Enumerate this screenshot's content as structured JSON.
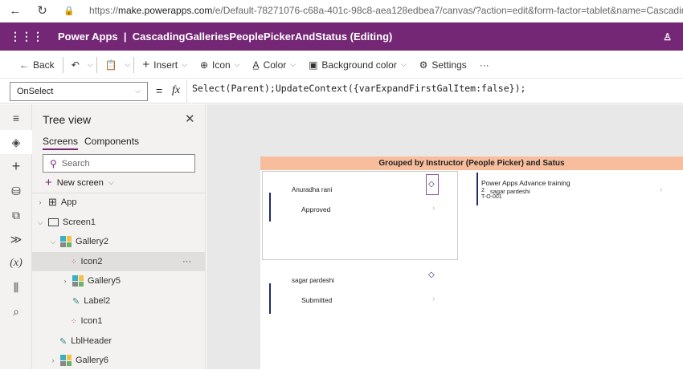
{
  "browser": {
    "url_prefix": "https://",
    "url_domain": "make.powerapps.com",
    "url_rest": "/e/Default-78271076-c68a-401c-98c8-aea128edbea7/canvas/?action=edit&form-factor=tablet&name=CascadingGalleriesPeo"
  },
  "header": {
    "title": "Power Apps  |  CascadingGalleriesPeoplePickerAndStatus (Editing)"
  },
  "toolbar": {
    "back": "Back",
    "insert": "Insert",
    "icon": "Icon",
    "color": "Color",
    "background_color": "Background color",
    "settings": "Settings",
    "more": "···"
  },
  "formula": {
    "property": "OnSelect",
    "equals": "=",
    "fx": "fx",
    "expression": "Select(Parent);UpdateContext({varExpandFirstGalItem:false});"
  },
  "tree": {
    "title": "Tree view",
    "tabs": [
      "Screens",
      "Components"
    ],
    "search_placeholder": "Search",
    "new_screen": "New screen",
    "items": [
      "App",
      "Screen1",
      "Gallery2",
      "Icon2",
      "Gallery5",
      "Label2",
      "Icon1",
      "LblHeader",
      "Gallery6"
    ],
    "more": "···"
  },
  "app": {
    "banner": "Grouped by Instructor (People Picker) and Satus",
    "groups": [
      {
        "name": "Anuradha rani",
        "status": "Approved"
      },
      {
        "name": "sagar pardeshi",
        "status": "Submitted"
      }
    ],
    "detail": {
      "title": "Power Apps Advance training",
      "count": "2",
      "person": "sagar pardeshi",
      "code": "T-O-001"
    }
  },
  "colors": {
    "brand": "#742774",
    "banner": "#f8bd9c",
    "accent_bar": "#1f2a6e"
  }
}
